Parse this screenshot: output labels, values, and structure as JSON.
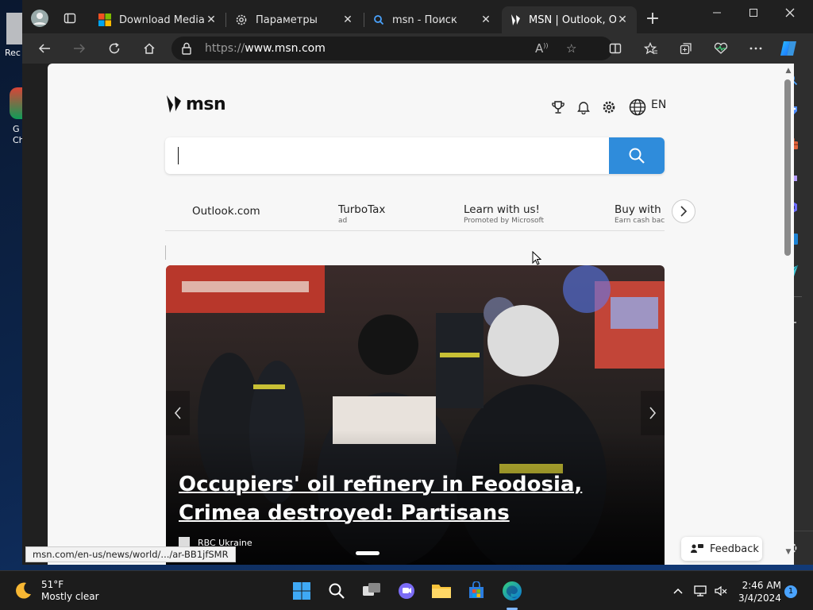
{
  "desktop": {
    "icons": [
      {
        "label": "Rec",
        "icon": "recycle-bin-icon"
      },
      {
        "label": "G Ch",
        "icon": "chrome-icon"
      }
    ]
  },
  "browser": {
    "tabs": [
      {
        "title": "Download Media Cr",
        "icon": "microsoft-logo-icon",
        "active": false
      },
      {
        "title": "Параметры",
        "icon": "gear-icon",
        "active": false
      },
      {
        "title": "msn - Поиск",
        "icon": "search-icon",
        "active": false
      },
      {
        "title": "MSN | Outlook, Offic",
        "icon": "msn-butterfly-icon",
        "active": true
      }
    ],
    "new_tab_label": "+",
    "address": {
      "prefix": "https://",
      "host": "www.msn.com"
    },
    "status_url": "msn.com/en-us/news/world/.../ar-BB1jfSMR"
  },
  "msn": {
    "logo_text": "msn",
    "language": "EN",
    "search_placeholder": "",
    "quicklinks": [
      {
        "title": "Outlook.com",
        "sub": ""
      },
      {
        "title": "TurboTax",
        "sub": "ad"
      },
      {
        "title": "Learn with us!",
        "sub": "Promoted by Microsoft"
      },
      {
        "title": "Buy with M",
        "sub": "Earn cash back,"
      }
    ],
    "hero": {
      "title": "Occupiers' oil refinery in Feodosia, Crimea destroyed: Partisans",
      "source": "RBC Ukraine"
    },
    "feedback_label": "Feedback"
  },
  "taskbar": {
    "weather": {
      "temp": "51°F",
      "desc": "Mostly clear"
    },
    "clock": {
      "time": "2:46 AM",
      "date": "3/4/2024"
    },
    "notifications": "1"
  },
  "colors": {
    "accent": "#2f8cdb",
    "tab_bg": "#202020",
    "toolbar_bg": "#2e2e2e",
    "page_bg": "#f7f7f7"
  }
}
